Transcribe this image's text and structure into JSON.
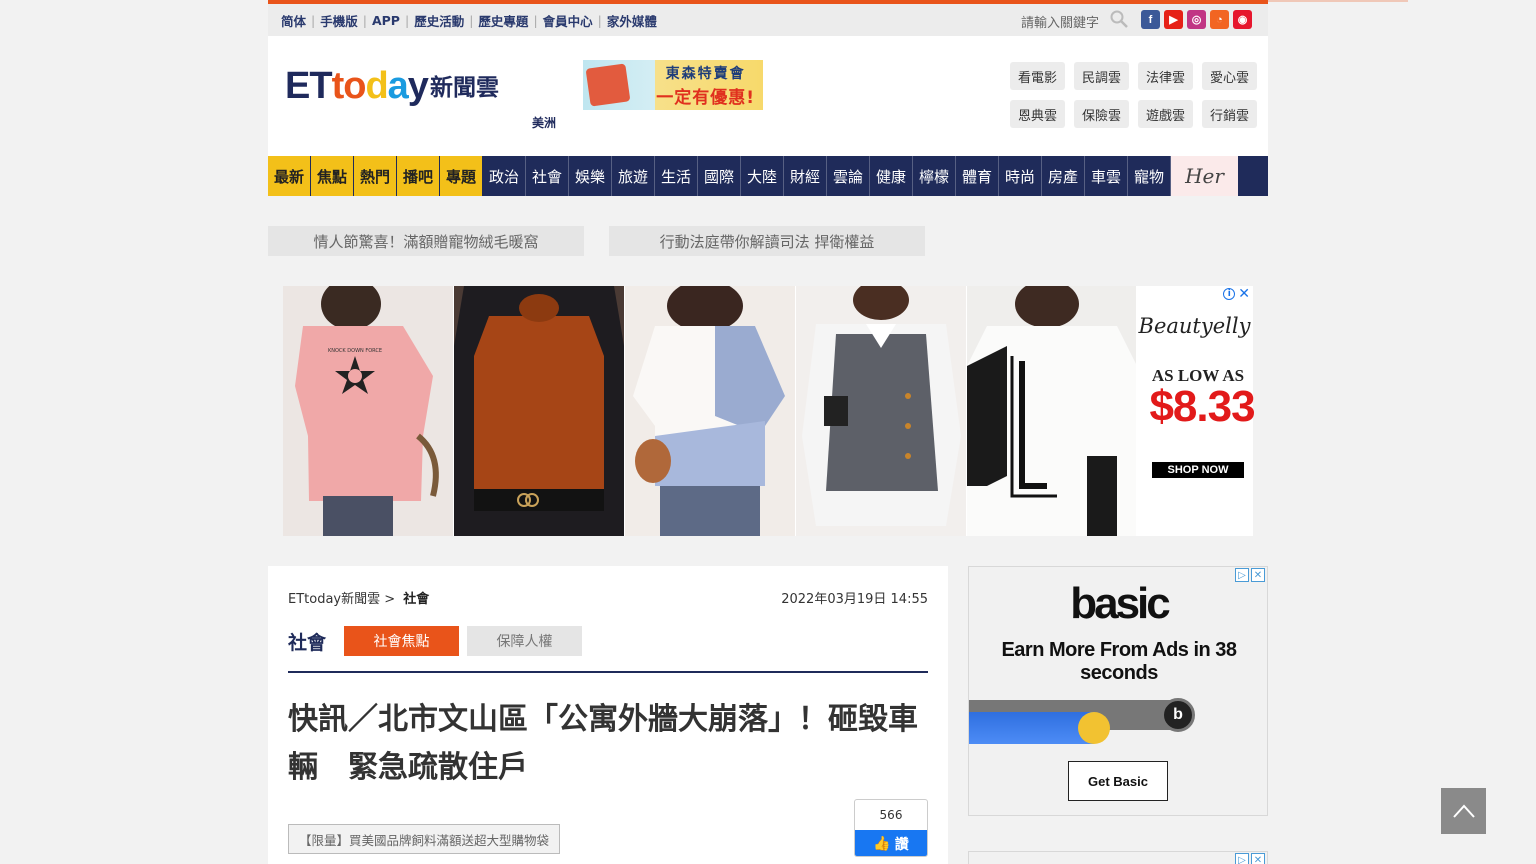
{
  "topbar": {
    "links": [
      "简体",
      "手機版",
      "APP",
      "歷史活動",
      "歷史專題",
      "會員中心",
      "家外媒體"
    ],
    "search_placeholder": "請輸入關鍵字",
    "social": [
      {
        "name": "facebook-icon",
        "glyph": "f",
        "color": "#3b5998"
      },
      {
        "name": "youtube-icon",
        "glyph": "▶",
        "color": "#e62117"
      },
      {
        "name": "instagram-icon",
        "glyph": "◎",
        "color": "#c13584"
      },
      {
        "name": "rss-icon",
        "glyph": "◔",
        "color": "#f26522"
      },
      {
        "name": "weibo-icon",
        "glyph": "◉",
        "color": "#e6162d"
      }
    ]
  },
  "header": {
    "logo_et": "ETtoday",
    "logo_cn": "新聞雲",
    "region": "美洲",
    "banner_line1": "東森特賣會",
    "banner_line2": "一定有優惠!",
    "clouds": [
      "看電影",
      "民調雲",
      "法律雲",
      "愛心雲",
      "恩典雲",
      "保險雲",
      "遊戲雲",
      "行銷雲"
    ]
  },
  "nav": {
    "highlight_items": [
      "最新",
      "焦點",
      "熱門",
      "播吧",
      "專題"
    ],
    "items": [
      "政治",
      "社會",
      "娛樂",
      "旅遊",
      "生活",
      "國際",
      "大陸",
      "財經",
      "雲論",
      "健康",
      "檸檬",
      "體育",
      "時尚",
      "房產",
      "車雲",
      "寵物"
    ],
    "her_label": "Her"
  },
  "promos": [
    "情人節驚喜！滿額贈寵物絨毛暖窩",
    "行動法庭帶你解讀司法 捍衛權益"
  ],
  "top_ad": {
    "brand": "Beautyelly",
    "low_label": "AS LOW AS",
    "price": "$8.33",
    "cta": "SHOP NOW",
    "star_text": "KNOCK DOWN FORCE"
  },
  "article": {
    "breadcrumb_home": "ETtoday新聞雲 >",
    "breadcrumb_section": "社會",
    "date": "2022年03月19日 14:55",
    "section": "社會",
    "tab_active": "社會焦點",
    "tab_inactive": "保障人權",
    "headline": "快訊／北市文山區「公寓外牆大崩落」！砸毀車輛　緊急疏散住戶",
    "promo_link": "【限量】買美國品牌飼料滿額送超大型購物袋",
    "fb_count": "566",
    "fb_like": "讚"
  },
  "side_ad": {
    "logo": "basic",
    "headline": "Earn More From Ads in 38 seconds",
    "cta": "Get Basic",
    "slider_level": 0.6
  },
  "colors": {
    "accent_orange": "#e9541a",
    "nav_blue": "#1f2b5a",
    "nav_highlight": "#f3c019"
  }
}
